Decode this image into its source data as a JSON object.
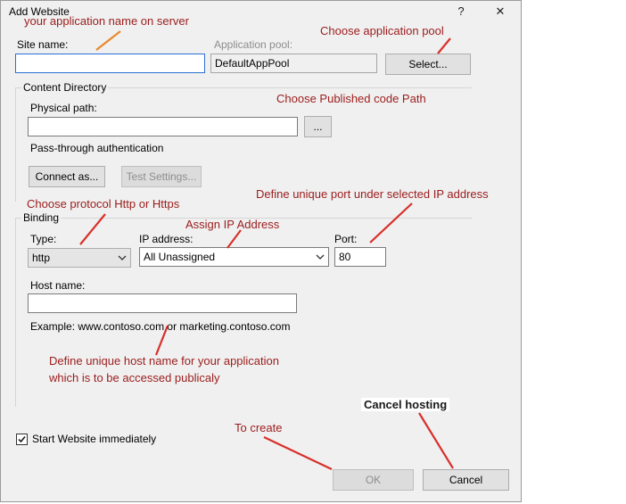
{
  "window": {
    "title": "Add Website",
    "help_glyph": "?",
    "close_glyph": "✕"
  },
  "site": {
    "site_name_label": "Site name:",
    "site_name_value": "",
    "app_pool_label": "Application pool:",
    "app_pool_value": "DefaultAppPool",
    "select_button": "Select..."
  },
  "content_directory": {
    "group_label": "Content Directory",
    "physical_path_label": "Physical path:",
    "physical_path_value": "",
    "browse_button": "...",
    "pass_through_label": "Pass-through authentication",
    "connect_as_button": "Connect as...",
    "test_settings_button": "Test Settings..."
  },
  "binding": {
    "group_label": "Binding",
    "type_label": "Type:",
    "type_value": "http",
    "ip_label": "IP address:",
    "ip_value": "All Unassigned",
    "port_label": "Port:",
    "port_value": "80",
    "host_name_label": "Host name:",
    "host_name_value": "",
    "example_text": "Example: www.contoso.com or marketing.contoso.com"
  },
  "start_website": {
    "label": "Start Website immediately",
    "checked": true
  },
  "footer": {
    "ok_button": "OK",
    "cancel_button": "Cancel"
  },
  "annotations": {
    "app_name": "your application name on server",
    "app_pool": "Choose application pool",
    "published_path": "Choose Published code Path",
    "protocol": "Choose protocol Http or Https",
    "port": "Define unique port under selected IP address",
    "ip": "Assign IP Address",
    "host_line1": "Define unique host name for your application",
    "host_line2": "which is to be accessed publicaly",
    "cancel": "Cancel hosting",
    "create": "To create"
  },
  "colors": {
    "annotation_text": "#9b1c1c",
    "arrow_red": "#d8302a",
    "arrow_orange": "#e8892b",
    "focus_border": "#2b6fd6"
  }
}
